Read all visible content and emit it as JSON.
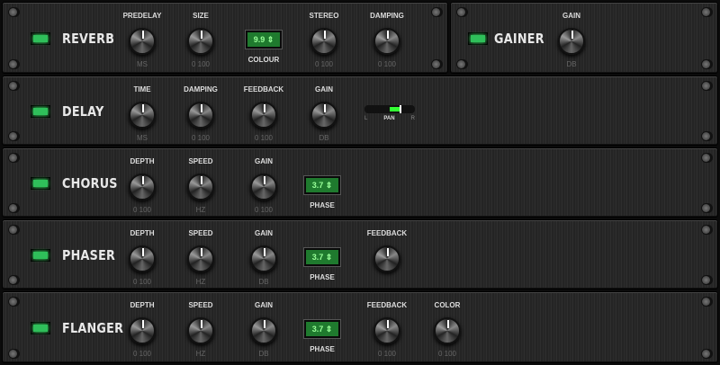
{
  "racks": [
    {
      "id": "reverb",
      "title": "REVERB",
      "controls": [
        {
          "type": "knob",
          "label": "PREDELAY",
          "sub": "MS"
        },
        {
          "type": "knob",
          "label": "SIZE",
          "sub": "0  100"
        },
        {
          "type": "display",
          "label": "COLOUR",
          "value": "9.9"
        },
        {
          "type": "knob",
          "label": "STEREO",
          "sub": "0  100"
        },
        {
          "type": "knob",
          "label": "DAMPING",
          "sub": "0  100"
        }
      ]
    },
    {
      "id": "gainer",
      "title": "GAINER",
      "controls": [
        {
          "type": "knob",
          "label": "GAIN",
          "sub": "DB"
        }
      ]
    },
    {
      "id": "delay",
      "title": "DELAY",
      "controls": [
        {
          "type": "knob",
          "label": "TIME",
          "sub": "MS"
        },
        {
          "type": "knob",
          "label": "DAMPING",
          "sub": "0  100"
        },
        {
          "type": "knob",
          "label": "FEEDBACK",
          "sub": "0  100"
        },
        {
          "type": "knob",
          "label": "GAIN",
          "sub": "DB"
        },
        {
          "type": "pan",
          "label": "PAN",
          "left": "L",
          "right": "R",
          "value": 0.7
        }
      ]
    },
    {
      "id": "chorus",
      "title": "CHORUS",
      "controls": [
        {
          "type": "knob",
          "label": "DEPTH",
          "sub": "0  100"
        },
        {
          "type": "knob",
          "label": "SPEED",
          "sub": "HZ"
        },
        {
          "type": "knob",
          "label": "GAIN",
          "sub": "0  100"
        },
        {
          "type": "display",
          "label": "PHASE",
          "value": "3.7"
        }
      ]
    },
    {
      "id": "phaser",
      "title": "PHASER",
      "controls": [
        {
          "type": "knob",
          "label": "DEPTH",
          "sub": "0  100"
        },
        {
          "type": "knob",
          "label": "SPEED",
          "sub": "HZ"
        },
        {
          "type": "knob",
          "label": "GAIN",
          "sub": "DB"
        },
        {
          "type": "display",
          "label": "PHASE",
          "value": "3.7"
        },
        {
          "type": "knob",
          "label": "FEEDBACK",
          "sub": ""
        }
      ]
    },
    {
      "id": "flanger",
      "title": "FLANGER",
      "controls": [
        {
          "type": "knob",
          "label": "DEPTH",
          "sub": "0  100"
        },
        {
          "type": "knob",
          "label": "SPEED",
          "sub": "HZ"
        },
        {
          "type": "knob",
          "label": "GAIN",
          "sub": "DB"
        },
        {
          "type": "display",
          "label": "PHASE",
          "value": "3.7"
        },
        {
          "type": "knob",
          "label": "FEEDBACK",
          "sub": "0  100"
        },
        {
          "type": "knob",
          "label": "COLOR",
          "sub": "0  100"
        }
      ]
    }
  ],
  "colors": {
    "led": "#2fbf5a",
    "display": "#1f7a2e"
  }
}
